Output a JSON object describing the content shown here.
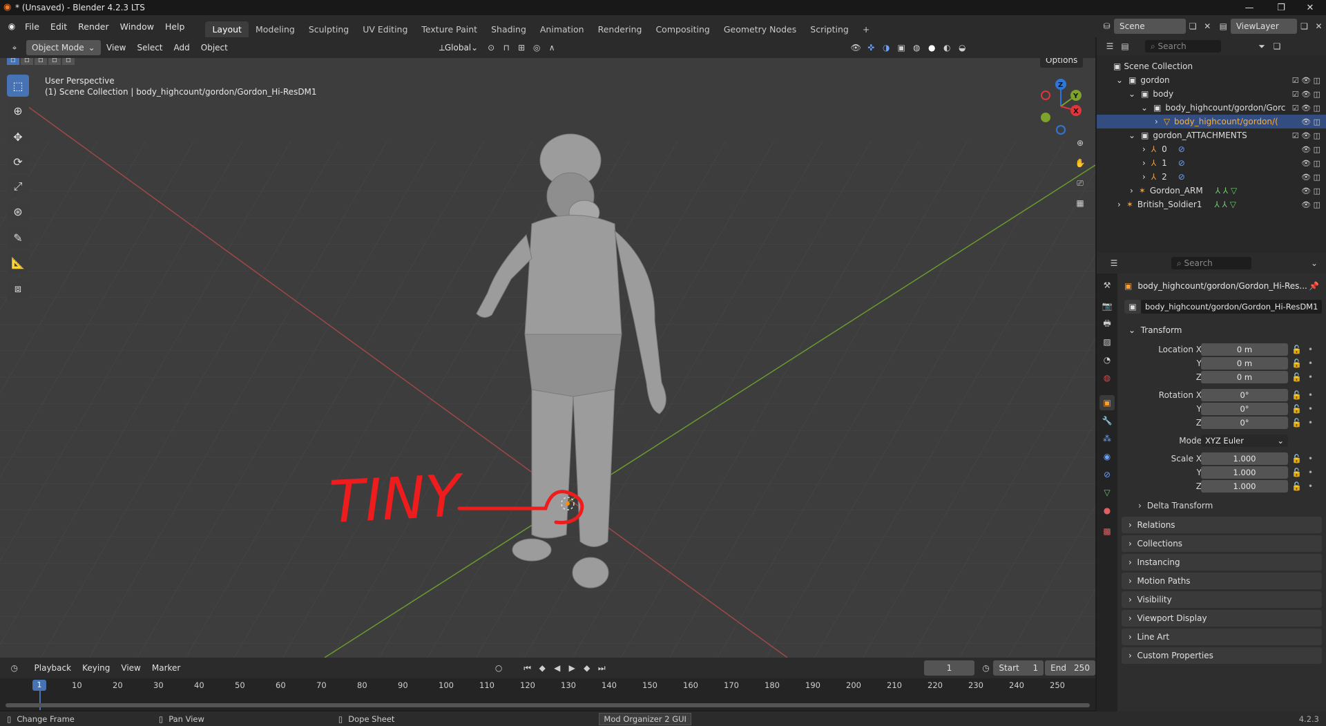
{
  "titlebar": {
    "title": "* (Unsaved) - Blender 4.2.3 LTS",
    "minimize": "—",
    "restore": "❐",
    "close": "✕"
  },
  "menu": [
    "File",
    "Edit",
    "Render",
    "Window",
    "Help"
  ],
  "workspaces": [
    "Layout",
    "Modeling",
    "Sculpting",
    "UV Editing",
    "Texture Paint",
    "Shading",
    "Animation",
    "Rendering",
    "Compositing",
    "Geometry Nodes",
    "Scripting",
    "+"
  ],
  "scene": {
    "name": "Scene",
    "view_layer": "ViewLayer"
  },
  "viewport_header": {
    "mode": "Object Mode",
    "menus": [
      "View",
      "Select",
      "Add",
      "Object"
    ],
    "transform": "Global",
    "options": "Options"
  },
  "viewport": {
    "perspective": "User Perspective",
    "context": "(1) Scene Collection | body_highcount/gordon/Gordon_Hi-ResDM1",
    "annotation": "TINY"
  },
  "gizmo": {
    "z": "Z",
    "y": "Y",
    "x": "X"
  },
  "outliner": {
    "search_placeholder": "Search",
    "rows": [
      {
        "label": "Scene Collection",
        "indent": 0
      },
      {
        "label": "gordon",
        "indent": 1
      },
      {
        "label": "body",
        "indent": 2
      },
      {
        "label": "body_highcount/gordon/Gorc",
        "indent": 3
      },
      {
        "label": "body_highcount/gordon/(",
        "indent": 4
      },
      {
        "label": "gordon_ATTACHMENTS",
        "indent": 2
      },
      {
        "label": "0",
        "indent": 3
      },
      {
        "label": "1",
        "indent": 3
      },
      {
        "label": "2",
        "indent": 3
      },
      {
        "label": "Gordon_ARM",
        "indent": 2
      },
      {
        "label": "British_Soldier1",
        "indent": 1
      }
    ]
  },
  "properties": {
    "search_placeholder": "Search",
    "object_name": "body_highcount/gordon/Gordon_Hi-Res...",
    "object_field": "body_highcount/gordon/Gordon_Hi-ResDM1",
    "transform_label": "Transform",
    "location_x_label": "Location X",
    "location_x": "0 m",
    "location_y_label": "Y",
    "location_y": "0 m",
    "location_z_label": "Z",
    "location_z": "0 m",
    "rotation_x_label": "Rotation X",
    "rotation_x": "0°",
    "rotation_y_label": "Y",
    "rotation_y": "0°",
    "rotation_z_label": "Z",
    "rotation_z": "0°",
    "mode_label": "Mode",
    "mode": "XYZ Euler",
    "scale_x_label": "Scale X",
    "scale_x": "1.000",
    "scale_y_label": "Y",
    "scale_y": "1.000",
    "scale_z_label": "Z",
    "scale_z": "1.000",
    "delta_transform": "Delta Transform",
    "sections": [
      "Relations",
      "Collections",
      "Instancing",
      "Motion Paths",
      "Visibility",
      "Viewport Display",
      "Line Art",
      "Custom Properties"
    ]
  },
  "timeline": {
    "menus": [
      "Playback",
      "Keying",
      "View",
      "Marker"
    ],
    "current_frame": "1",
    "start_label": "Start",
    "start": "1",
    "end_label": "End",
    "end": "250",
    "ticks": [
      "10",
      "20",
      "30",
      "40",
      "50",
      "60",
      "70",
      "80",
      "90",
      "100",
      "110",
      "120",
      "130",
      "140",
      "150",
      "160",
      "170",
      "180",
      "190",
      "200",
      "210",
      "220",
      "230",
      "240",
      "250"
    ]
  },
  "statusbar": {
    "change_frame": "Change Frame",
    "pan_view": "Pan View",
    "dope_sheet": "Dope Sheet",
    "mo2": "Mod Organizer 2 GUI",
    "version": "4.2.3"
  }
}
